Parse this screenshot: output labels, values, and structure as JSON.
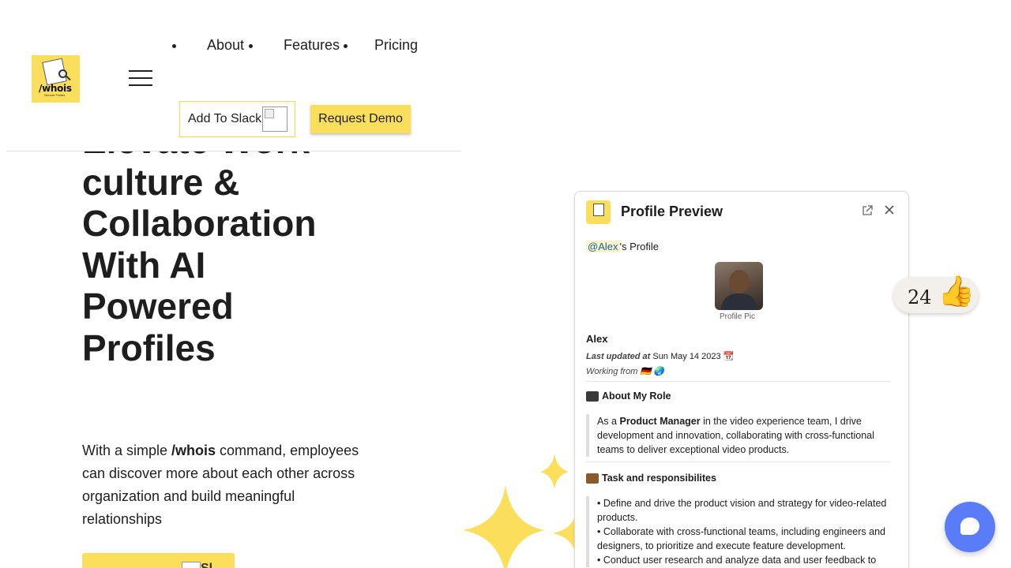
{
  "header": {
    "logo_text": "/whois",
    "logo_sub": "Discover Profiles",
    "nav": [
      {
        "label": "About"
      },
      {
        "label": "Features"
      },
      {
        "label": "Pricing"
      }
    ],
    "add_to_slack_label": "Add To Slack",
    "request_demo_label": "Request Demo"
  },
  "hero": {
    "title_line1": "Elevate Work",
    "title_line2": "culture &",
    "title_line3": "Collaboration",
    "title_with": "With ",
    "title_ai": "AI",
    "title_powered": "Powered",
    "title_profiles": "Profiles",
    "sub_before": "With a simple ",
    "sub_command": "/whois",
    "sub_after": " command, employees can discover more about each other across organization and build meaningful relationships",
    "cta_partial": "Sl"
  },
  "card": {
    "title": "Profile Preview",
    "mention": "@Alex",
    "mention_suffix": "'s Profile",
    "avatar_caption": "Profile Pic",
    "name": "Alex",
    "last_updated_label": "Last updated at",
    "last_updated_value": " Sun May 14 2023 📆",
    "working_from": "Working from 🇩🇪 🌏",
    "about_title": "About My Role",
    "about_before": "As a ",
    "about_role": "Product Manager",
    "about_after": " in the video experience team, I drive development and innovation, collaborating with cross-functional teams to deliver exceptional video products.",
    "tasks_title": "Task and responsibilites",
    "tasks": [
      "• Define and drive the product vision and strategy for video-related products.",
      "• Collaborate with cross-functional teams, including engineers and designers, to prioritize and execute feature development.",
      "• Conduct user research and analyze data and user feedback to"
    ]
  },
  "reaction": {
    "count": "24",
    "emoji": "👍"
  },
  "colors": {
    "brand_yellow": "#fbde5c",
    "chat_blue": "#5b7cf7"
  }
}
